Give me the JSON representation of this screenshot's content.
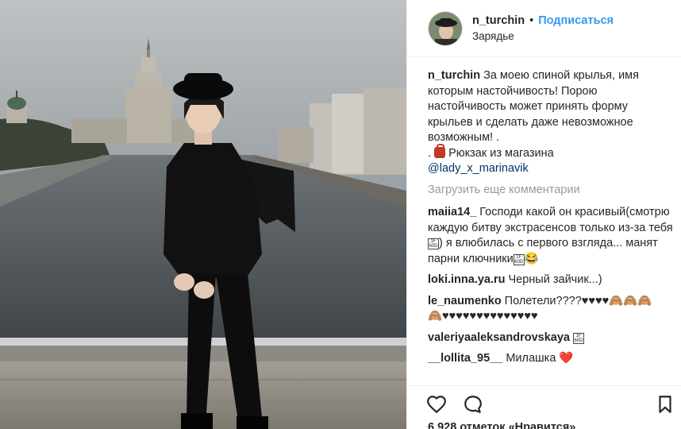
{
  "post": {
    "username": "n_turchin",
    "separator": "•",
    "follow_label": "Подписаться",
    "location": "Зарядье"
  },
  "caption": {
    "username": "n_turchin",
    "text": "За моею спиной крылья, имя которым настойчивость! Порою настойчивость может принять форму крыльев и сделать даже невозможное возможным! .",
    "line2_prefix": ".",
    "line2_text": "Рюкзак из магазина",
    "mention": "@lady_x_marinavik"
  },
  "load_more_label": "Загрузить еще комментарии",
  "comments": [
    {
      "username": "maiia14_",
      "text": "Господи какой он красивый(смотрю каждую битву экстрасенсов только из-за тебя",
      "text2": ") я влюбилась с первого взгляда... манят парни ключники",
      "emoji": "😂"
    },
    {
      "username": "loki.inna.ya.ru",
      "text": "Черный зайчик...)"
    },
    {
      "username": "le_naumenko",
      "text": "Полетели????♥♥♥♥🙈🙈🙈",
      "text2": "🙈♥♥♥♥♥♥♥♥♥♥♥♥♥♥"
    },
    {
      "username": "valeriyaaleksandrovskaya",
      "text": ""
    },
    {
      "username": "__lollita_95__",
      "text": "Милашка",
      "emoji": "❤️"
    }
  ],
  "likes_text": "6 928 отметок «Нравится»",
  "icons": {
    "like": "heart-outline-icon",
    "comment": "comment-bubble-icon",
    "save": "bookmark-icon"
  },
  "colors": {
    "follow": "#3897f0",
    "muted": "#999999",
    "text": "#262626",
    "mention": "#003569"
  }
}
